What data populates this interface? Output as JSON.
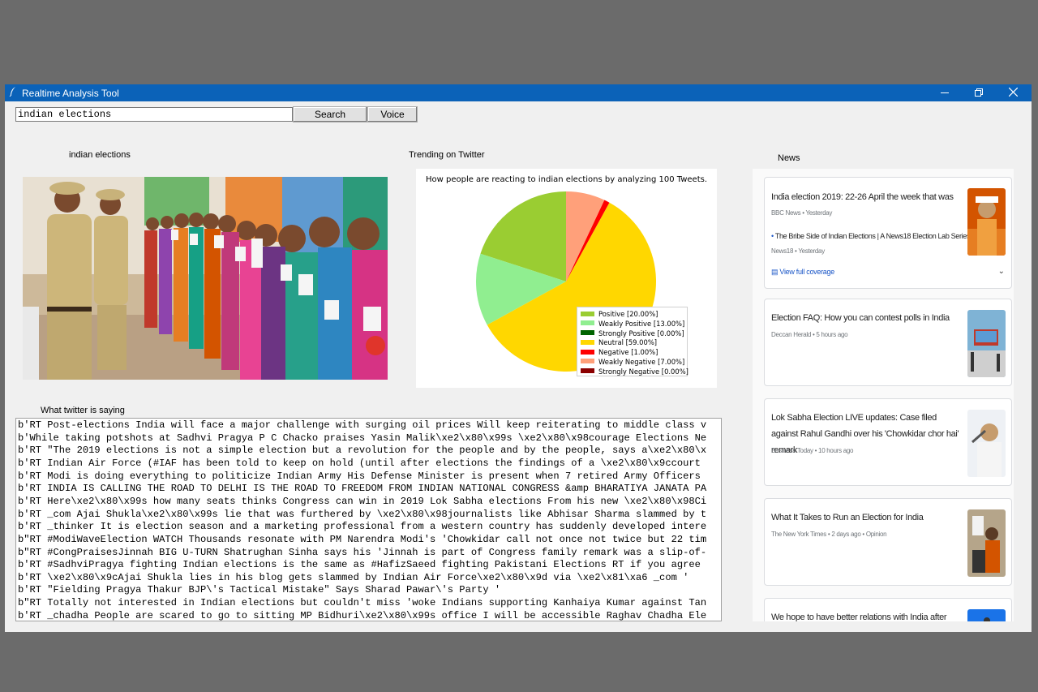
{
  "window": {
    "title": "Realtime Analysis Tool",
    "icon": "feather-icon",
    "controls": {
      "minimize": "—",
      "maximize": "❐",
      "close": "✕"
    }
  },
  "search": {
    "value": "indian elections",
    "search_button": "Search",
    "voice_button": "Voice"
  },
  "image_section": {
    "label": "indian elections"
  },
  "twitter_section": {
    "label": "Trending on Twitter"
  },
  "news_section": {
    "label": "News"
  },
  "tweets_section": {
    "label": "What twitter is saying"
  },
  "chart_data": {
    "type": "pie",
    "title": "How people are reacting to indian elections by analyzing 100 Tweets.",
    "legend_position": "bottom-right",
    "slices": [
      {
        "label": "Positive [20.00%]",
        "value": 20,
        "color": "#9acd32"
      },
      {
        "label": "Weakly Positive [13.00%]",
        "value": 13,
        "color": "#90ee90"
      },
      {
        "label": "Strongly Positive [0.00%]",
        "value": 0,
        "color": "#006400"
      },
      {
        "label": "Neutral [59.00%]",
        "value": 59,
        "color": "#ffd700"
      },
      {
        "label": "Negative [1.00%]",
        "value": 1,
        "color": "#ff0000"
      },
      {
        "label": "Weakly Negative [7.00%]",
        "value": 7,
        "color": "#ffa07a"
      },
      {
        "label": "Strongly Negative [0.00%]",
        "value": 0,
        "color": "#8b0000"
      }
    ]
  },
  "news": [
    {
      "headline": "India election 2019: 22-26 April the week that was",
      "source": "BBC News",
      "time": "Yesterday",
      "sub_headline": "The Bribe Side of Indian Elections | A News18 Election Lab Series",
      "sub_source": "News18",
      "sub_time": "Yesterday",
      "coverage": "View full coverage"
    },
    {
      "headline": "Election FAQ: How you can contest polls in India",
      "source": "Deccan Herald",
      "time": "5 hours ago"
    },
    {
      "headline": "Lok Sabha Election LIVE updates: Case filed against Rahul Gandhi over his 'Chowkidar chor hai' remark",
      "source": "Business Today",
      "time": "10 hours ago"
    },
    {
      "headline": "What It Takes to Run an Election for India",
      "source": "The New York Times",
      "time": "2 days ago",
      "tag": "Opinion"
    },
    {
      "headline": "We hope to have better relations with India after elections: Pak"
    }
  ],
  "tweets": [
    "b'RT Post-elections India will face a major challenge with surging oil prices Will keep reiterating to middle class v",
    "b'While taking potshots at Sadhvi Pragya P C Chacko praises Yasin Malik\\xe2\\x80\\x99s \\xe2\\x80\\x98courage Elections Ne",
    "b'RT \"The 2019 elections is not a simple election but a revolution for the people and by the people, says a\\xe2\\x80\\x",
    "b'RT Indian Air Force (#IAF has been told to keep on hold (until after elections the findings of a \\xe2\\x80\\x9ccourt",
    "b'RT Modi is doing everything to politicize Indian Army His Defense Minister is present when 7 retired Army Officers",
    "b'RT INDIA IS CALLING THE ROAD TO DELHI IS THE ROAD TO FREEDOM FROM INDIAN NATIONAL CONGRESS &amp BHARATIYA JANATA PA",
    "b'RT Here\\xe2\\x80\\x99s how many seats thinks Congress can win in 2019 Lok Sabha elections From his new \\xe2\\x80\\x98Ci",
    "b'RT _com Ajai Shukla\\xe2\\x80\\x99s lie that was furthered by \\xe2\\x80\\x98journalists like Abhisar Sharma slammed by t",
    "b'RT _thinker It is election season and a marketing professional from a western country has suddenly developed intere",
    "b\"RT #ModiWaveElection WATCH Thousands resonate with PM Narendra Modi's 'Chowkidar call not once not twice but 22 tim",
    "b\"RT #CongPraisesJinnah BIG U-TURN Shatrughan Sinha says his 'Jinnah is part of Congress family remark was a slip-of-",
    "b'RT #SadhviPragya fighting Indian elections is the same as #HafizSaeed fighting Pakistani Elections RT if you agree",
    "b'RT \\xe2\\x80\\x9cAjai Shukla lies in his blog gets slammed by Indian Air Force\\xe2\\x80\\x9d via \\xe2\\x81\\xa6 _com '",
    "b'RT \"Fielding Pragya Thakur BJP\\'s Tactical Mistake\" Says Sharad Pawar\\'s Party '",
    "b\"RT Totally not interested in Indian elections but couldn't miss 'woke Indians supporting Kanhaiya Kumar against Tan",
    "b'RT _chadha People are scared to go to sitting MP Bidhuri\\xe2\\x80\\x99s office I will be accessible Raghav Chadha Ele"
  ]
}
